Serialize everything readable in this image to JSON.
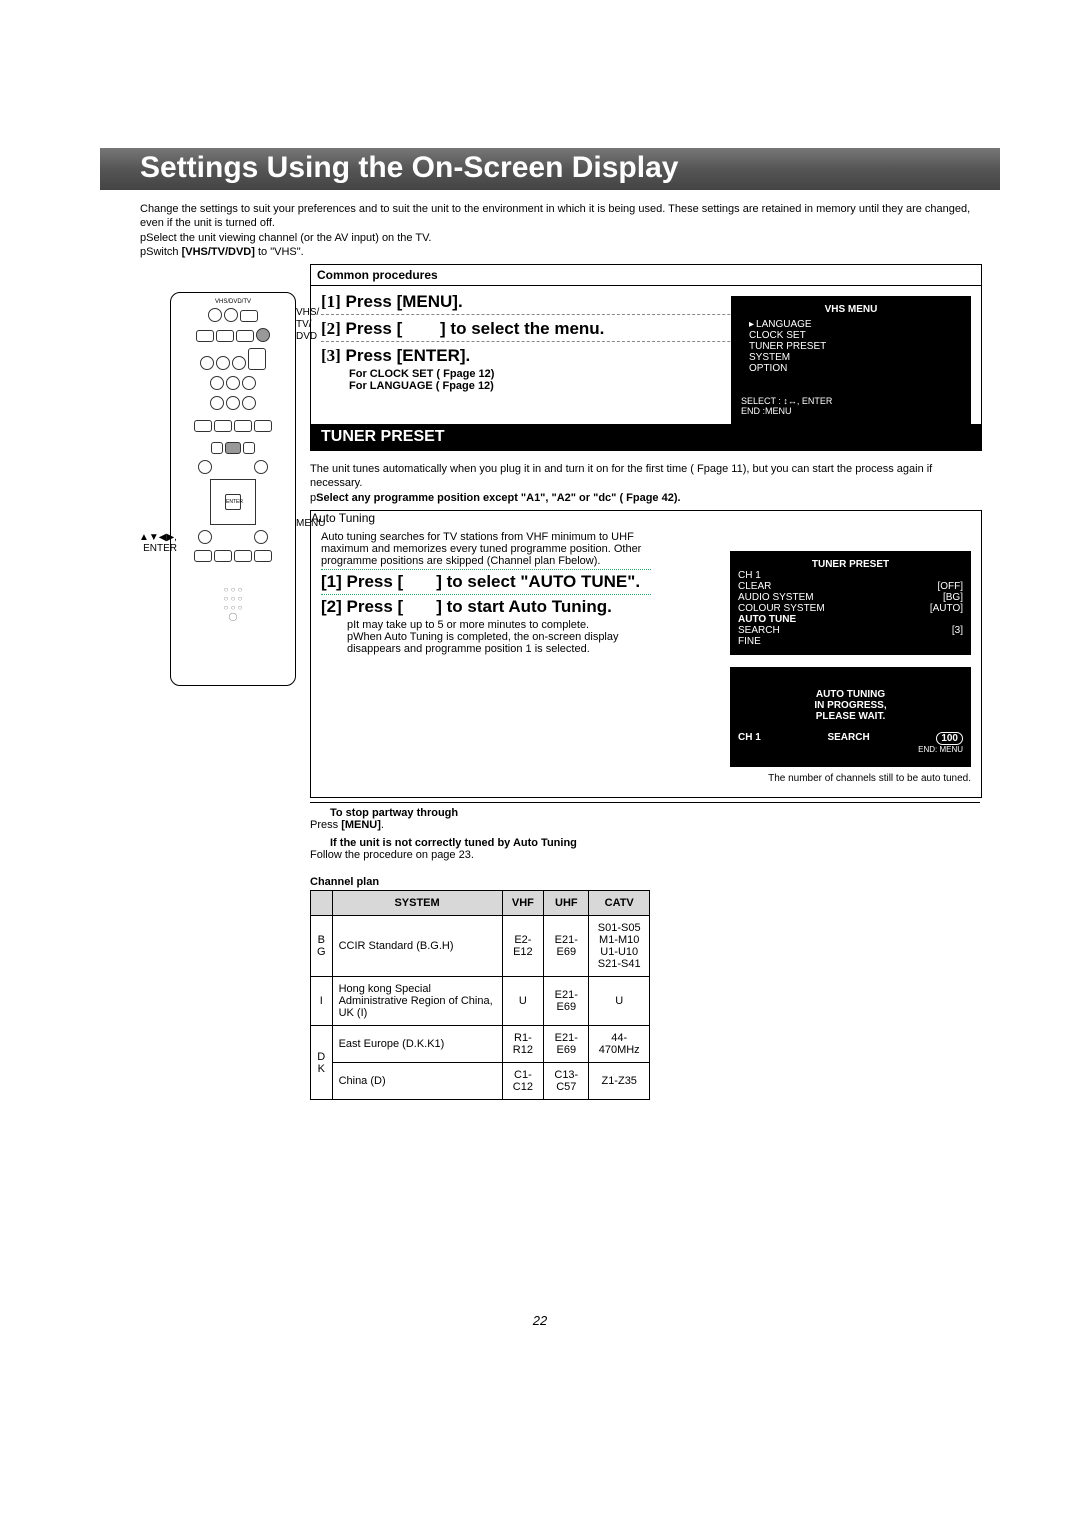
{
  "header": "Settings Using the On-Screen Display",
  "intro": {
    "l1": "Change the settings to suit your preferences and to suit the unit to the environment in which it is being used. These settings are retained in memory until they are changed, even if the unit is turned off.",
    "l2": "pSelect the unit viewing channel (or the AV input) on the TV.",
    "l3": "pSwitch [VHS/TV/DVD] to \"VHS\"."
  },
  "remote_notes": {
    "vhs": "VHS/\nTV/\nDVD",
    "enter": "34 21,\nENTER",
    "menu": "MENU"
  },
  "common": {
    "title": "Common procedures",
    "s1": "[1] Press [MENU].",
    "s2": "[2] Press [          ] to select the menu.",
    "s3": "[3] Press [ENTER].",
    "clock": "For CLOCK SET ( Fpage 12)",
    "lang": "For LANGUAGE ( Fpage 12)"
  },
  "vhs_menu": {
    "title": "VHS MENU",
    "items": [
      "LANGUAGE",
      "CLOCK SET",
      "TUNER PRESET",
      "SYSTEM",
      "OPTION"
    ],
    "footer1": "SELECT : ↕↔, ENTER",
    "footer2": "END        :MENU"
  },
  "tuner_band": "TUNER PRESET",
  "tuner_text": {
    "l1": "The unit tunes automatically when you plug it in and turn it on for the first time ( Fpage 11), but you can start the process again if necessary.",
    "l2": "pSelect any programme position except \"A1\", \"A2\" or \"dc\" ( Fpage 42)."
  },
  "auto": {
    "title": "Auto Tuning",
    "desc": "Auto tuning searches for TV stations from VHF minimum to UHF maximum and memorizes every tuned programme position. Other programme positions are skipped (Channel plan  Fbelow).",
    "s1": "[1] Press [          ] to select \"AUTO TUNE\".",
    "s2": "[2] Press [          ] to start Auto Tuning.",
    "n1": "pIt may take up to 5 or more minutes to complete.",
    "n2": "pWhen Auto Tuning is completed, the on-screen display disappears and programme position 1 is selected."
  },
  "tuner_osd": {
    "title": "TUNER PRESET",
    "ch": "CH 1",
    "rows": [
      {
        "l": "CLEAR",
        "v": "[OFF]"
      },
      {
        "l": "AUDIO SYSTEM",
        "v": "[BG]"
      },
      {
        "l": "COLOUR SYSTEM",
        "v": "[AUTO]"
      }
    ],
    "auto": "AUTO TUNE",
    "search": "SEARCH",
    "fine": "FINE",
    "three": "[3]"
  },
  "progress": {
    "l1": "AUTO TUNING",
    "l2": "IN PROGRESS,",
    "l3": "PLEASE WAIT.",
    "ch": "CH 1",
    "search": "SEARCH",
    "end": "END: MENU",
    "count": "100"
  },
  "countnote": "The number of channels still to be auto tuned.",
  "stop": {
    "h1": "To stop partway through",
    "t1": "Press [MENU].",
    "h2": "If the unit is not correctly tuned by Auto Tuning",
    "t2": "Follow the procedure on page 23."
  },
  "chplan": {
    "title": "Channel plan",
    "headers": [
      "",
      "SYSTEM",
      "VHF",
      "UHF",
      "CATV"
    ],
    "rows": [
      {
        "code": "B\nG",
        "sys": "CCIR Standard (B.G.H)",
        "vhf": "E2-E12",
        "uhf": "E21-E69",
        "catv": "S01-S05\nM1-M10\nU1-U10\nS21-S41"
      },
      {
        "code": "I",
        "sys": "Hong kong Special Administrative Region of China, UK (I)",
        "vhf": "U",
        "uhf": "E21-E69",
        "catv": "U"
      },
      {
        "code": "D\nK",
        "sys": "East Europe (D.K.K1)",
        "vhf": "R1-R12",
        "uhf": "E21-E69",
        "catv": "44-470MHz"
      },
      {
        "code": "",
        "sys": "China (D)",
        "vhf": "C1-C12",
        "uhf": "C13-C57",
        "catv": "Z1-Z35"
      }
    ]
  },
  "pagenum": "22"
}
